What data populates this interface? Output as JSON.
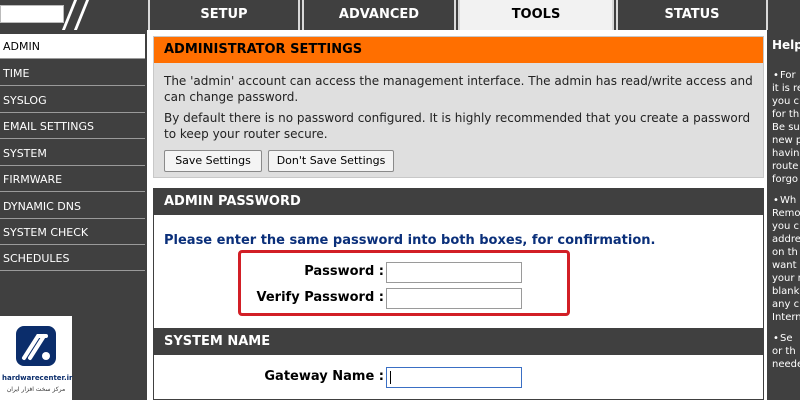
{
  "tabs": [
    {
      "label": "SETUP"
    },
    {
      "label": "ADVANCED"
    },
    {
      "label": "TOOLS"
    },
    {
      "label": "STATUS"
    }
  ],
  "sidebar": {
    "items": [
      {
        "label": "ADMIN"
      },
      {
        "label": "TIME"
      },
      {
        "label": "SYSLOG"
      },
      {
        "label": "EMAIL SETTINGS"
      },
      {
        "label": "SYSTEM"
      },
      {
        "label": "FIRMWARE"
      },
      {
        "label": "DYNAMIC DNS"
      },
      {
        "label": "SYSTEM CHECK"
      },
      {
        "label": "SCHEDULES"
      }
    ]
  },
  "admin_settings": {
    "title": "ADMINISTRATOR SETTINGS",
    "text1": "The 'admin' account can access the management interface. The admin has read/write access and can change password.",
    "text2": "By default there is no password configured. It is highly recommended that you create a password to keep your router secure.",
    "save_label": "Save Settings",
    "dont_save_label": "Don't Save Settings"
  },
  "admin_password": {
    "title": "ADMIN PASSWORD",
    "hint": "Please enter the same password into both boxes, for confirmation.",
    "password_label": "Password :",
    "verify_label": "Verify Password :",
    "password_value": "",
    "verify_value": ""
  },
  "system_name": {
    "title": "SYSTEM NAME",
    "gateway_label": "Gateway Name :",
    "gateway_value": ""
  },
  "help": {
    "title": "Help",
    "fragments": [
      "For",
      "it is re",
      "you c",
      "for th",
      "Be su",
      "new p",
      "havin",
      "route",
      "forgo",
      "Wh",
      "Remo",
      "you c",
      "addre",
      "on th",
      "want t",
      "your r",
      "blank",
      "any c",
      "Intern",
      "Se",
      "or th",
      "neede"
    ]
  },
  "watermark": {
    "name": "hardwarecenter.ir",
    "subtitle": "مرکز سخت افزار ایران"
  },
  "colors": {
    "accent": "#ff6f00",
    "highlight": "#d21f26",
    "dark": "#404040"
  }
}
